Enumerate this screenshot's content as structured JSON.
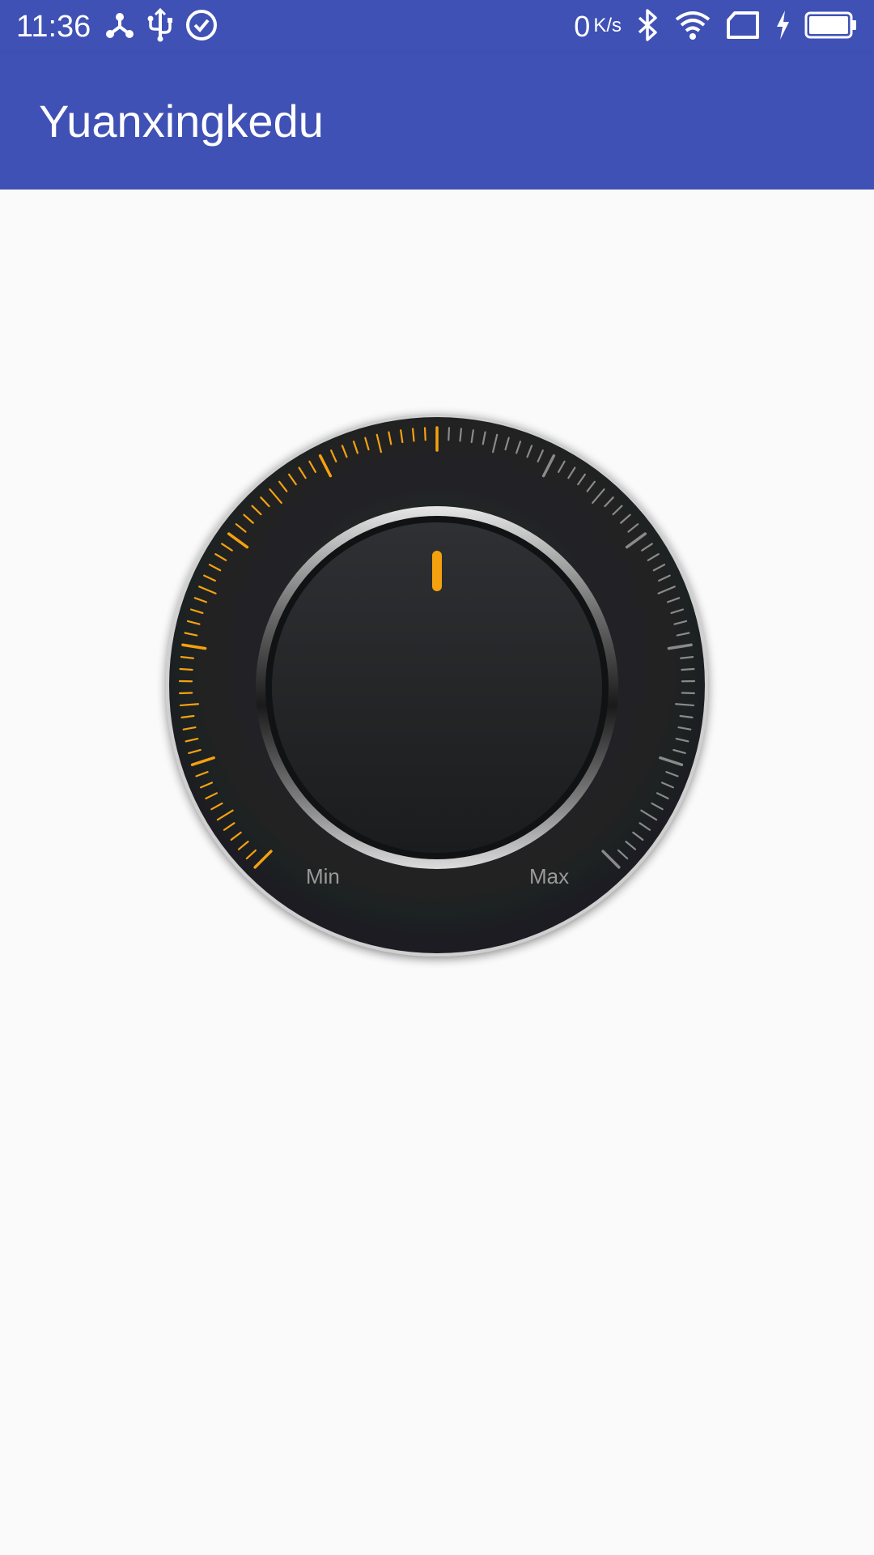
{
  "status_bar": {
    "time": "11:36",
    "net_speed_value": "0",
    "net_speed_unit": "K/s",
    "left_icons": [
      "network-share-icon",
      "usb-icon",
      "check-circle-icon"
    ],
    "right_icons": [
      "bluetooth-icon",
      "wifi-icon",
      "sim-card-icon",
      "charging-bolt-icon",
      "battery-icon"
    ]
  },
  "app_bar": {
    "title": "Yuanxingkedu"
  },
  "dial": {
    "min_label": "Min",
    "max_label": "Max",
    "level_fraction": 0.5,
    "tick_count": 100,
    "major_tick_every": 10,
    "start_angle_deg": -135,
    "end_angle_deg": 135,
    "colors": {
      "active_tick": "#f5a10f",
      "inactive_tick": "#8a8a8a",
      "indicator": "#f5a10f",
      "face": "#202123",
      "bezel": "#c8c8c8",
      "label": "#9a9a9a"
    }
  },
  "colors": {
    "primary": "#3f51b5",
    "background": "#fafafa"
  }
}
